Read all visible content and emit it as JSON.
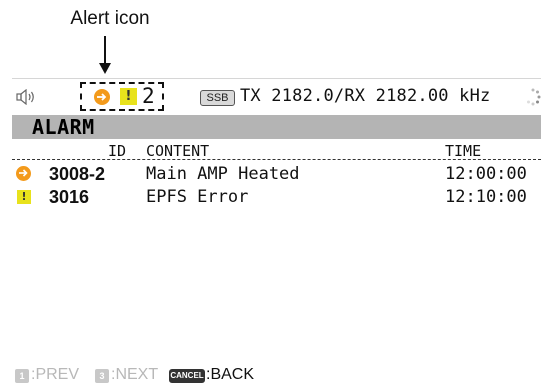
{
  "callout": {
    "label": "Alert icon"
  },
  "status": {
    "alert_count": "2",
    "warning_symbol": "!",
    "mode_badge": "SSB",
    "frequency": "TX 2182.0/RX 2182.00 kHz",
    "icons": [
      "speaker-icon",
      "alert-circle-icon",
      "warning-icon",
      "busy-spinner-icon"
    ]
  },
  "screen": {
    "title": "ALARM"
  },
  "table": {
    "columns": {
      "id": "ID",
      "content": "CONTENT",
      "time": "TIME"
    },
    "rows": [
      {
        "icon": "alert-circle-icon",
        "id": "3008-2",
        "content": "Main AMP Heated",
        "time": "12:00:00"
      },
      {
        "icon": "warning-icon",
        "symbol": "!",
        "id": "3016",
        "content": "EPFS Error",
        "time": "12:10:00"
      }
    ]
  },
  "softkeys": {
    "prev_key": "1",
    "prev_label": ":PREV",
    "next_key": "3",
    "next_label": ":NEXT",
    "cancel_key": "CANCEL",
    "back_label": ":BACK"
  },
  "colors": {
    "alert_orange": "#f39a1b",
    "warning_yellow": "#e8e21c",
    "title_bar": "#b4b4b4"
  }
}
